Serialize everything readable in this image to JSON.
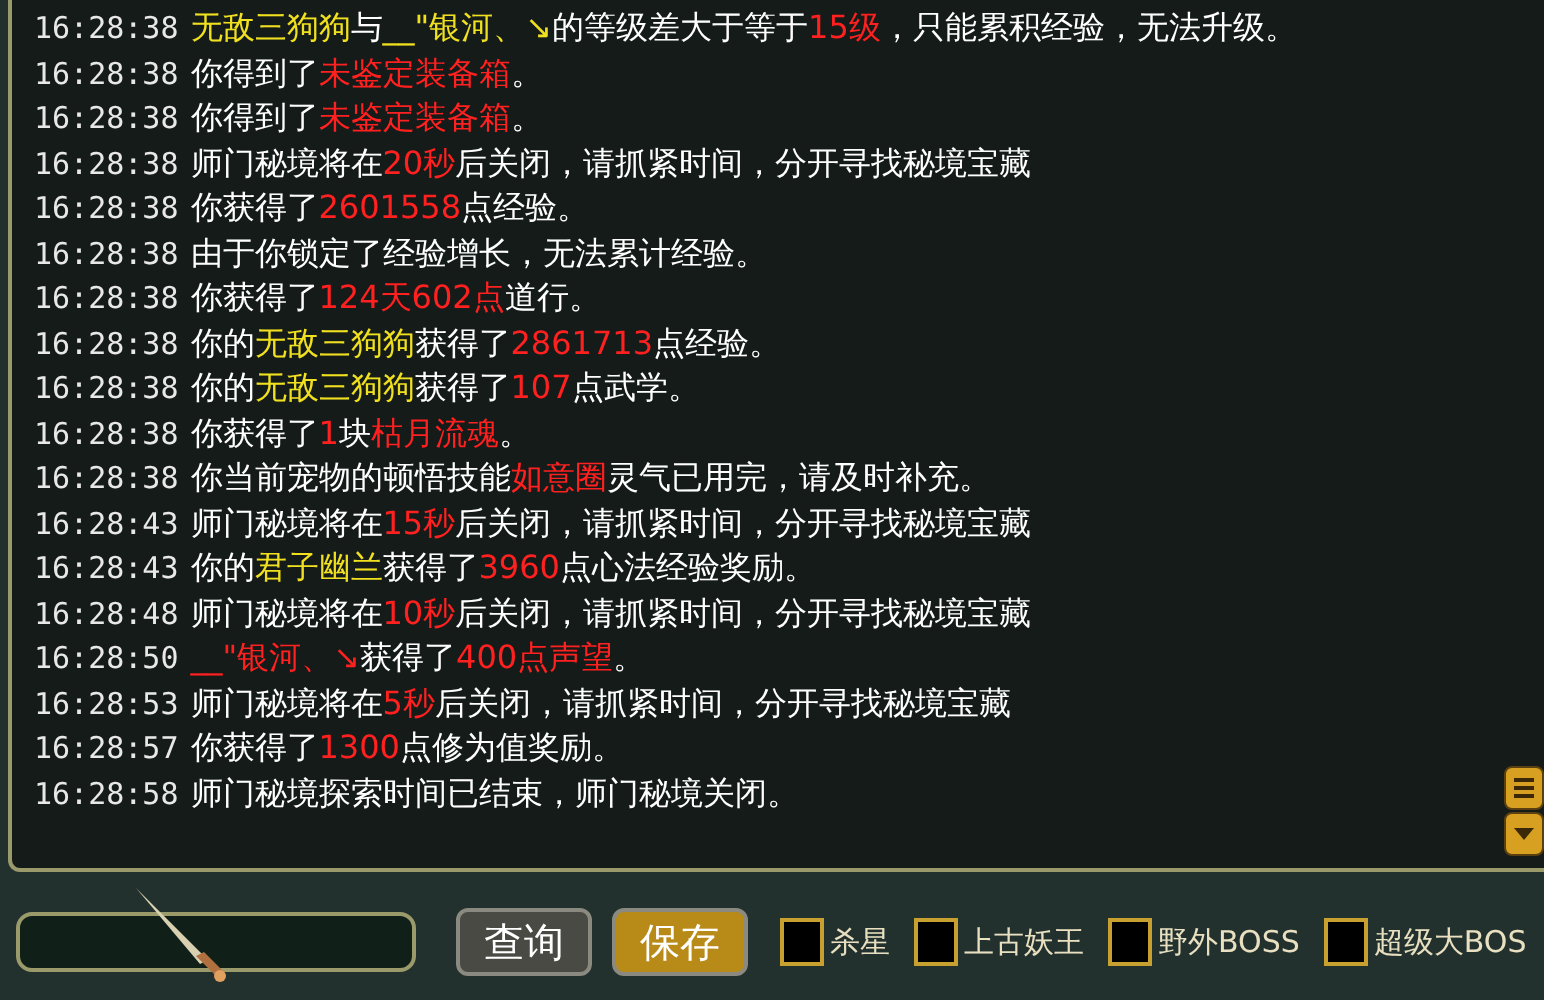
{
  "chat_log": [
    {
      "time": "16:28:38",
      "parts": [
        {
          "text": "无敌三狗狗",
          "color": "#f0e020"
        },
        {
          "text": "与",
          "color": "#ffffff"
        },
        {
          "text": "__\"银河、↘",
          "color": "#f0e020"
        },
        {
          "text": "的等级差大于等于",
          "color": "#ffffff"
        },
        {
          "text": "15级",
          "color": "#ff2020"
        },
        {
          "text": "，只能累积经验，无法升级。",
          "color": "#ffffff"
        }
      ]
    },
    {
      "time": "16:28:38",
      "parts": [
        {
          "text": "你得到了",
          "color": "#ffffff"
        },
        {
          "text": "未鉴定装备箱",
          "color": "#ff2020"
        },
        {
          "text": "。",
          "color": "#ffffff"
        }
      ]
    },
    {
      "time": "16:28:38",
      "parts": [
        {
          "text": "你得到了",
          "color": "#ffffff"
        },
        {
          "text": "未鉴定装备箱",
          "color": "#ff2020"
        },
        {
          "text": "。",
          "color": "#ffffff"
        }
      ]
    },
    {
      "time": "16:28:38",
      "parts": [
        {
          "text": "师门秘境将在",
          "color": "#ffffff"
        },
        {
          "text": "20秒",
          "color": "#ff2020"
        },
        {
          "text": "后关闭，请抓紧时间，分开寻找秘境宝藏",
          "color": "#ffffff"
        }
      ]
    },
    {
      "time": "16:28:38",
      "parts": [
        {
          "text": "你获得了",
          "color": "#ffffff"
        },
        {
          "text": "2601558",
          "color": "#ff2020"
        },
        {
          "text": "点经验。",
          "color": "#ffffff"
        }
      ]
    },
    {
      "time": "16:28:38",
      "parts": [
        {
          "text": "由于你锁定了经验增长，无法累计经验。",
          "color": "#ffffff"
        }
      ]
    },
    {
      "time": "16:28:38",
      "parts": [
        {
          "text": "你获得了",
          "color": "#ffffff"
        },
        {
          "text": "124天602点",
          "color": "#ff2020"
        },
        {
          "text": "道行。",
          "color": "#ffffff"
        }
      ]
    },
    {
      "time": "16:28:38",
      "parts": [
        {
          "text": "你的",
          "color": "#ffffff"
        },
        {
          "text": "无敌三狗狗",
          "color": "#f0e020"
        },
        {
          "text": "获得了",
          "color": "#ffffff"
        },
        {
          "text": "2861713",
          "color": "#ff2020"
        },
        {
          "text": "点经验。",
          "color": "#ffffff"
        }
      ]
    },
    {
      "time": "16:28:38",
      "parts": [
        {
          "text": "你的",
          "color": "#ffffff"
        },
        {
          "text": "无敌三狗狗",
          "color": "#f0e020"
        },
        {
          "text": "获得了",
          "color": "#ffffff"
        },
        {
          "text": "107",
          "color": "#ff2020"
        },
        {
          "text": "点武学。",
          "color": "#ffffff"
        }
      ]
    },
    {
      "time": "16:28:38",
      "parts": [
        {
          "text": "你获得了",
          "color": "#ffffff"
        },
        {
          "text": "1",
          "color": "#ff2020"
        },
        {
          "text": "块",
          "color": "#ffffff"
        },
        {
          "text": "枯月流魂",
          "color": "#ff2020"
        },
        {
          "text": "。",
          "color": "#ffffff"
        }
      ]
    },
    {
      "time": "16:28:38",
      "parts": [
        {
          "text": "你当前宠物的顿悟技能",
          "color": "#ffffff"
        },
        {
          "text": "如意圈",
          "color": "#ff2020"
        },
        {
          "text": "灵气已用完，请及时补充。",
          "color": "#ffffff"
        }
      ]
    },
    {
      "time": "16:28:43",
      "parts": [
        {
          "text": "师门秘境将在",
          "color": "#ffffff"
        },
        {
          "text": "15秒",
          "color": "#ff2020"
        },
        {
          "text": "后关闭，请抓紧时间，分开寻找秘境宝藏",
          "color": "#ffffff"
        }
      ]
    },
    {
      "time": "16:28:43",
      "parts": [
        {
          "text": "你的",
          "color": "#ffffff"
        },
        {
          "text": "君子幽兰",
          "color": "#f0e020"
        },
        {
          "text": "获得了",
          "color": "#ffffff"
        },
        {
          "text": "3960",
          "color": "#ff2020"
        },
        {
          "text": "点心法经验奖励。",
          "color": "#ffffff"
        }
      ]
    },
    {
      "time": "16:28:48",
      "parts": [
        {
          "text": "师门秘境将在",
          "color": "#ffffff"
        },
        {
          "text": "10秒",
          "color": "#ff2020"
        },
        {
          "text": "后关闭，请抓紧时间，分开寻找秘境宝藏",
          "color": "#ffffff"
        }
      ]
    },
    {
      "time": "16:28:50",
      "parts": [
        {
          "text": "__\"银河、↘",
          "color": "#ff2020"
        },
        {
          "text": "获得了",
          "color": "#ffffff"
        },
        {
          "text": "400点声望",
          "color": "#ff2020"
        },
        {
          "text": "。",
          "color": "#ffffff"
        }
      ]
    },
    {
      "time": "16:28:53",
      "parts": [
        {
          "text": "师门秘境将在",
          "color": "#ffffff"
        },
        {
          "text": "5秒",
          "color": "#ff2020"
        },
        {
          "text": "后关闭，请抓紧时间，分开寻找秘境宝藏",
          "color": "#ffffff"
        }
      ]
    },
    {
      "time": "16:28:57",
      "parts": [
        {
          "text": "你获得了",
          "color": "#ffffff"
        },
        {
          "text": "1300",
          "color": "#ff2020"
        },
        {
          "text": "点修为值奖励。",
          "color": "#ffffff"
        }
      ]
    },
    {
      "time": "16:28:58",
      "parts": [
        {
          "text": "师门秘境探索时间已结束，师门秘境关闭。",
          "color": "#ffffff"
        }
      ]
    }
  ],
  "buttons": [
    {
      "label": "查询",
      "selected": false
    },
    {
      "label": "保存",
      "selected": true
    }
  ],
  "filters": [
    {
      "label": "杀星",
      "checked": false
    },
    {
      "label": "上古妖王",
      "checked": false
    },
    {
      "label": "野外BOSS",
      "checked": false
    },
    {
      "label": "超级大BOS",
      "checked": false
    }
  ]
}
